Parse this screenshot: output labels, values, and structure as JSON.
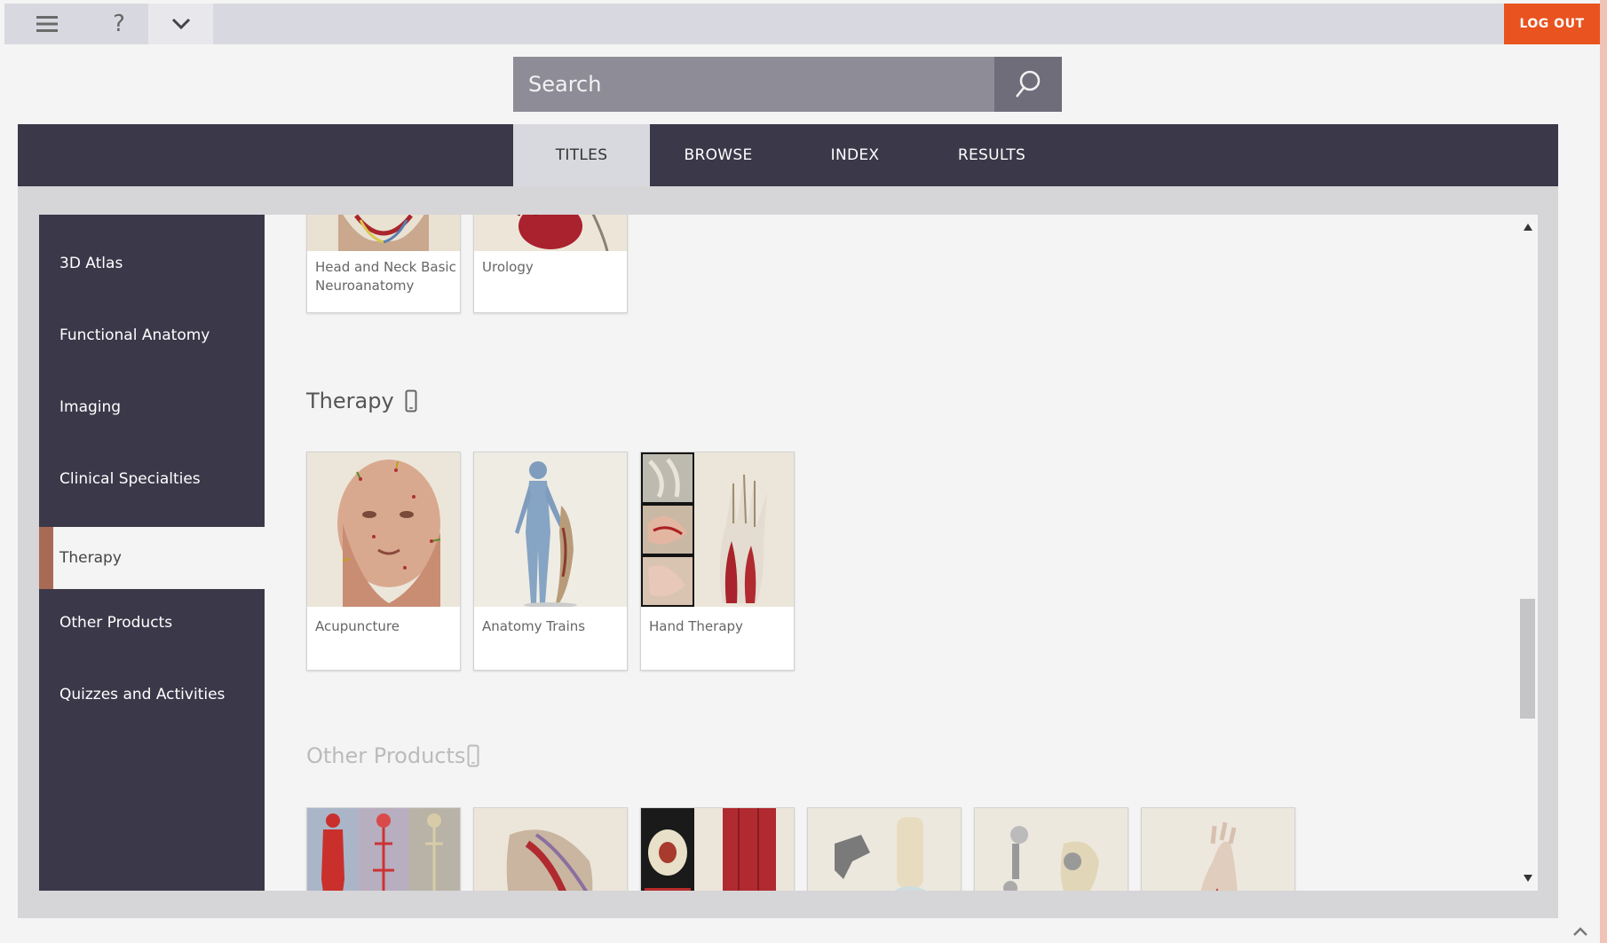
{
  "topbar": {
    "menu_icon": "hamburger-icon",
    "help_label": "?",
    "more_icon": "chevron-down-icon",
    "logout_label": "LOG OUT",
    "logout_color": "#e8531f"
  },
  "search": {
    "placeholder": "Search",
    "icon": "search-icon"
  },
  "nav": {
    "tabs": [
      {
        "label": "TITLES",
        "active": true
      },
      {
        "label": "BROWSE",
        "active": false
      },
      {
        "label": "INDEX",
        "active": false
      },
      {
        "label": "RESULTS",
        "active": false
      }
    ]
  },
  "sidebar": {
    "items": [
      {
        "label": "3D Atlas"
      },
      {
        "label": "Functional Anatomy"
      },
      {
        "label": "Imaging"
      },
      {
        "label": "Clinical Specialties"
      },
      {
        "label": "Therapy",
        "active": true
      },
      {
        "label": "Other Products"
      },
      {
        "label": "Quizzes and Activities"
      }
    ]
  },
  "content": {
    "top_cards": [
      {
        "label": "Head and Neck Basic Neuroanatomy"
      },
      {
        "label": "Urology"
      }
    ],
    "sections": [
      {
        "title": "Therapy",
        "icon": "mobile-device-icon",
        "cards": [
          {
            "label": "Acupuncture"
          },
          {
            "label": "Anatomy Trains"
          },
          {
            "label": "Hand Therapy"
          }
        ]
      },
      {
        "title": "Other Products",
        "icon": "mobile-device-icon",
        "cards": [
          {
            "label": ""
          },
          {
            "label": ""
          },
          {
            "label": ""
          },
          {
            "label": ""
          },
          {
            "label": ""
          },
          {
            "label": ""
          }
        ]
      }
    ]
  },
  "colors": {
    "nav_bg": "#3b3849",
    "active_marker": "#a96a55"
  }
}
